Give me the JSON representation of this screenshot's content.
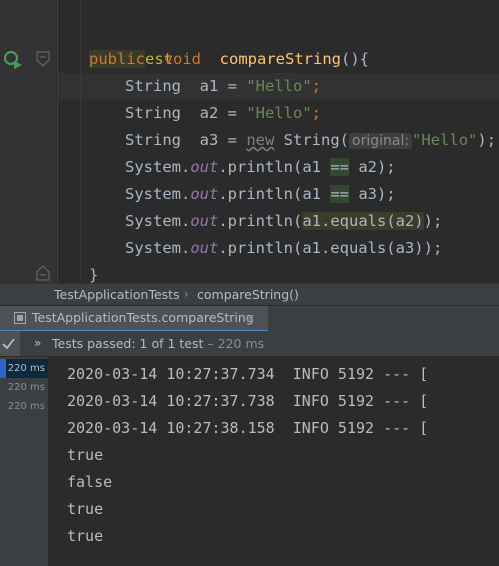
{
  "editor": {
    "annotation": "@Test",
    "method_modifier": "public",
    "method_return": "void",
    "method_name": "compareString",
    "method_paren_open": "(){",
    "lines": {
      "a1_type": "String",
      "a1_var": "a1 = ",
      "a1_val": "\"Hello\"",
      "a2_type": "String",
      "a2_var": "a2 = ",
      "a2_val": "\"Hello\"",
      "a3_type": "String",
      "a3_var": "a3 = ",
      "a3_new": "new",
      "a3_class": " String(",
      "a3_hint": "original:",
      "a3_val": "\"Hello\"",
      "a3_close": ");",
      "print1_prefix": "System.",
      "print1_out": "out",
      "print1_call": ".println(a1 ",
      "print1_op": "==",
      "print1_end": " a2);",
      "print2_prefix": "System.",
      "print2_out": "out",
      "print2_call": ".println(a1 ",
      "print2_op": "==",
      "print2_end": " a3);",
      "print3_prefix": "System.",
      "print3_out": "out",
      "print3_call": ".println(",
      "print3_expr": "a1.equals(a2)",
      "print3_end": ");",
      "print4_prefix": "System.",
      "print4_out": "out",
      "print4_call": ".println(a1.equals(a3));",
      "closing_brace": "}",
      "semicolon": ";"
    },
    "icons": {
      "run": "run-test-icon",
      "fold": "fold-marker-icon"
    }
  },
  "breadcrumb": {
    "class_name": "TestApplicationTests",
    "separator": "›",
    "method_name": "compareString()"
  },
  "run_tab": {
    "label": "TestApplicationTests.compareString",
    "close": "×",
    "icon": "test-config-icon"
  },
  "status": {
    "chevron": "»",
    "passed_label": "Tests passed: ",
    "passed_count": "1",
    "of_text": " of 1 test",
    "duration": " – 220 ms",
    "check_icon": "check-icon"
  },
  "tree": {
    "rows": [
      "220 ms",
      "220 ms",
      "220 ms"
    ]
  },
  "console": {
    "lines": [
      "2020-03-14 10:27:37.734  INFO 5192 --- [",
      "2020-03-14 10:27:37.738  INFO 5192 --- [",
      "2020-03-14 10:27:38.158  INFO 5192 --- [",
      "true",
      "false",
      "true",
      "true"
    ]
  },
  "colors": {
    "editor_bg": "#2b2b2b",
    "keyword": "#cc7832",
    "string": "#6a8759",
    "function": "#ffc66d",
    "annotation": "#bbb529",
    "field": "#9876aa",
    "text": "#a9b7c6",
    "run_green": "#499c54",
    "selection_blue": "#2f65ca"
  }
}
